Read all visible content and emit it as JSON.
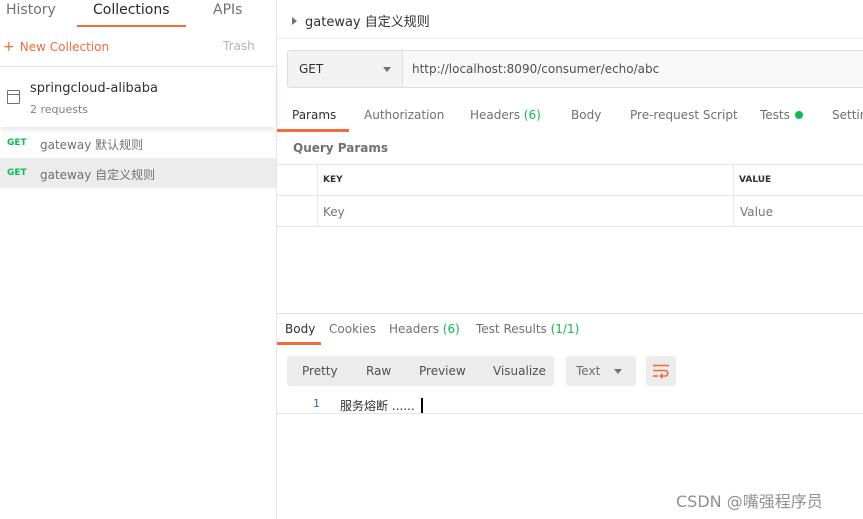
{
  "sidebar": {
    "tabs": [
      "History",
      "Collections",
      "APIs"
    ],
    "active_tab": "Collections",
    "new_collection": "New Collection",
    "trash": "Trash",
    "collection": {
      "name": "springcloud-alibaba",
      "count": "2 requests"
    },
    "requests": [
      {
        "method": "GET",
        "name": "gateway 默认规则"
      },
      {
        "method": "GET",
        "name": "gateway 自定义规则"
      }
    ]
  },
  "request": {
    "title": "gateway 自定义规则",
    "method": "GET",
    "url": "http://localhost:8090/consumer/echo/abc"
  },
  "tabs": {
    "params": "Params",
    "authorization": "Authorization",
    "headers": "Headers",
    "headers_count": "(6)",
    "body": "Body",
    "prerequest": "Pre-request Script",
    "tests": "Tests",
    "settings": "Settings"
  },
  "query_params": {
    "label": "Query Params",
    "col_key": "KEY",
    "col_value": "VALUE",
    "key_placeholder": "Key",
    "value_placeholder": "Value"
  },
  "response": {
    "tabs": {
      "body": "Body",
      "cookies": "Cookies",
      "headers": "Headers",
      "headers_count": "(6)",
      "test_results": "Test Results",
      "test_results_count": "(1/1)"
    },
    "views": [
      "Pretty",
      "Raw",
      "Preview",
      "Visualize"
    ],
    "format": "Text",
    "line_number": "1",
    "body_text": "服务熔断 ......"
  },
  "watermark": "CSDN @嘴强程序员",
  "colors": {
    "accent": "#f26b3a",
    "method_get": "#0cbb52",
    "tests_dot": "#0cbb52"
  }
}
